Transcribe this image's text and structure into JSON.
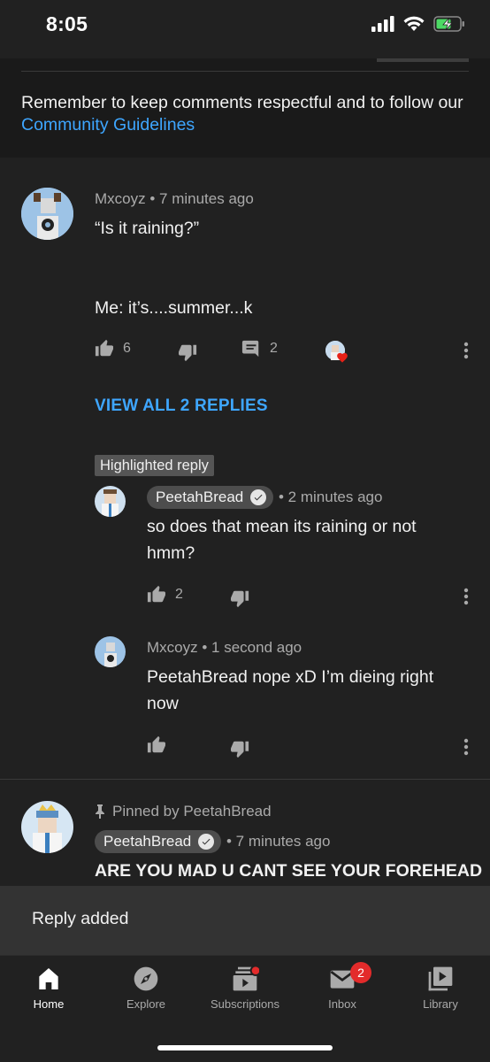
{
  "status_bar": {
    "time": "8:05"
  },
  "guidelines": {
    "text": "Remember to keep comments respectful and to follow our ",
    "link": "Community Guidelines"
  },
  "comment": {
    "author": "Mxcoyz",
    "time": "• 7 minutes ago",
    "line1": "“Is it raining?”",
    "line2": "Me: it’s....summer...k",
    "likes": "6",
    "replies_count": "2",
    "view_replies": "VIEW ALL 2 REPLIES"
  },
  "highlighted_label": "Highlighted reply",
  "replies": [
    {
      "author": "PeetahBread",
      "time": "• 2 minutes ago",
      "text": "so does that mean its raining or not hmm?",
      "likes": "2"
    },
    {
      "author": "Mxcoyz",
      "time": "• 1 second ago",
      "text": "PeetahBread nope xD I’m dieing right now",
      "likes": ""
    }
  ],
  "pinned_comment": {
    "pinned_by": "Pinned by PeetahBread",
    "author": "PeetahBread",
    "time": "• 7 minutes ago",
    "text": "ARE YOU MAD U CANT SEE YOUR FOREHEAD"
  },
  "toast": {
    "text": "Reply added"
  },
  "nav": {
    "items": [
      {
        "label": "Home",
        "icon": "home-icon"
      },
      {
        "label": "Explore",
        "icon": "compass-icon"
      },
      {
        "label": "Subscriptions",
        "icon": "subscriptions-icon"
      },
      {
        "label": "Inbox",
        "icon": "mail-icon"
      },
      {
        "label": "Library",
        "icon": "library-icon"
      }
    ],
    "inbox_badge": "2"
  },
  "colors": {
    "background": "#212121",
    "link": "#3ea6ff",
    "badge_red": "#e32b2b"
  }
}
